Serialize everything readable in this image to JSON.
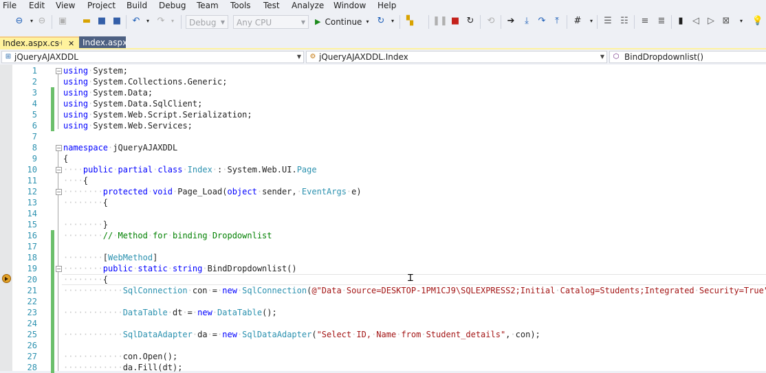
{
  "menu": [
    "File",
    "Edit",
    "View",
    "Project",
    "Build",
    "Debug",
    "Team",
    "Tools",
    "Test",
    "Analyze",
    "Window",
    "Help"
  ],
  "toolbar": {
    "config": "Debug",
    "platform": "Any CPU",
    "continue_label": "Continue"
  },
  "tabs": [
    {
      "label": "Index.aspx.cs",
      "active": true
    },
    {
      "label": "Index.aspx",
      "active": false
    }
  ],
  "nav": {
    "project": "jQueryAJAXDDL",
    "class": "jQueryAJAXDDL.Index",
    "member": "BindDropdownlist()"
  },
  "code_lines": [
    {
      "n": "1",
      "text": "using System;"
    },
    {
      "n": "2",
      "text": "using System.Collections.Generic;"
    },
    {
      "n": "3",
      "text": "using System.Data;"
    },
    {
      "n": "4",
      "text": "using System.Data.SqlClient;"
    },
    {
      "n": "5",
      "text": "using System.Web.Script.Serialization;"
    },
    {
      "n": "6",
      "text": "using System.Web.Services;"
    },
    {
      "n": "7",
      "text": ""
    },
    {
      "n": "8",
      "text": "namespace jQueryAJAXDDL"
    },
    {
      "n": "9",
      "text": "{"
    },
    {
      "n": "10",
      "text": "····public partial class Index : System.Web.UI.Page"
    },
    {
      "n": "11",
      "text": "····{"
    },
    {
      "n": "12",
      "text": "········protected void Page_Load(object sender, EventArgs e)"
    },
    {
      "n": "13",
      "text": "········{"
    },
    {
      "n": "14",
      "text": ""
    },
    {
      "n": "15",
      "text": "········}"
    },
    {
      "n": "16",
      "text": "········// Method for binding Dropdownlist"
    },
    {
      "n": "17",
      "text": ""
    },
    {
      "n": "18",
      "text": "········[WebMethod]"
    },
    {
      "n": "19",
      "text": "········public static string BindDropdownlist()"
    },
    {
      "n": "20",
      "text": "········{"
    },
    {
      "n": "21",
      "text": "············SqlConnection con = new SqlConnection(@\"Data Source=DESKTOP-1PM1CJ9\\SQLEXPRESS2;Initial Catalog=Students;Integrated Security=True\");"
    },
    {
      "n": "22",
      "text": ""
    },
    {
      "n": "23",
      "text": "············DataTable dt = new DataTable();"
    },
    {
      "n": "24",
      "text": ""
    },
    {
      "n": "25",
      "text": "············SqlDataAdapter da = new SqlDataAdapter(\"Select ID, Name from Student_details\", con);"
    },
    {
      "n": "26",
      "text": ""
    },
    {
      "n": "27",
      "text": "············con.Open();"
    },
    {
      "n": "28",
      "text": "············da.Fill(dt);"
    }
  ],
  "colors": {
    "keyword": "#0000ff",
    "type": "#2b91af",
    "string": "#a31515",
    "comment": "#008000",
    "line_number": "#2b91af",
    "change_bar": "#6bbf6b",
    "active_tab": "#fff29d",
    "inactive_tab": "#4d6082"
  },
  "icons": [
    "back-icon",
    "forward-icon",
    "new-project-icon",
    "open-folder-icon",
    "save-icon",
    "save-all-icon",
    "undo-icon",
    "redo-icon",
    "continue-play-icon",
    "restart-icon",
    "pause-icon",
    "stop-icon",
    "refresh-icon",
    "show-next-statement-icon",
    "step-into-icon",
    "step-over-icon",
    "step-out-icon",
    "hex-icon",
    "bookmark-icon",
    "lightbulb-icon",
    "code-file-icon",
    "class-icon",
    "method-icon",
    "breakpoint-arrow-icon"
  ]
}
